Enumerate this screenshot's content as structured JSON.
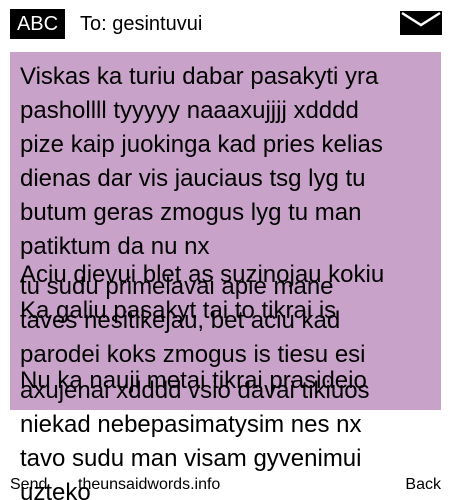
{
  "header": {
    "input_mode": "ABC",
    "recipient": "To: gesintuvui",
    "icon": "envelope-icon"
  },
  "message": {
    "background_color": "#c8a2c8",
    "lines": [
      "Viskas ka turiu dabar pasakyti yra",
      "pashollll tyyyyy naaaxujjjj xdddd",
      "pize kaip juokinga kad pries kelias",
      "dienas dar vis jauciaus tsg lyg tu",
      "butum geras zmogus lyg tu man",
      "patiktum da nu nx",
      "Aciu dievui blet as suzinojau kokiu",
      "tu sudu primelavai apie mane",
      "Ka galiu pasakyt tai to tikrai is",
      "taves nesitikejau, bet aciu kad",
      "parodei koks zmogus is tiesu esi",
      "Nu ka nauji metai tikrai prasideio",
      "axujenai xdddd vsio davai tikiuos",
      "niekad nebepasimatysim nes nx",
      "tavo sudu man visam gyvenimui",
      "uzteko"
    ]
  },
  "softkeys": {
    "left": "Send",
    "center": "theunsaidwords.info",
    "right": "Back"
  }
}
